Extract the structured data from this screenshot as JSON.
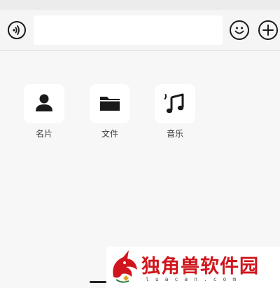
{
  "chat_bar": {
    "input_value": "",
    "icons": [
      "voice-icon",
      "emoji-icon",
      "plus-icon"
    ]
  },
  "panel": {
    "items": [
      {
        "label": "名片",
        "icon": "person-icon"
      },
      {
        "label": "文件",
        "icon": "folder-icon"
      },
      {
        "label": "音乐",
        "icon": "music-note-icon"
      }
    ]
  },
  "watermark": {
    "brand_name": "独角兽软件园",
    "url": "luacan.com"
  },
  "colors": {
    "background": "#f7f7f7",
    "tile_background": "#ffffff",
    "icon": "#1a1a1a",
    "brand_red": "#d0151c"
  }
}
